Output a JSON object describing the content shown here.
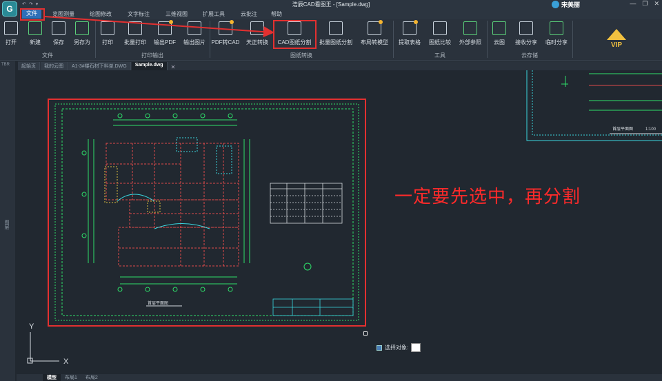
{
  "app": {
    "title": "浩辰CAD看图王 - [Sample.dwg]",
    "logo_letter": "G",
    "brand": "宋美丽",
    "window_controls": [
      "—",
      "❐",
      "✕"
    ]
  },
  "menu": {
    "items": [
      "文件",
      "览图测量",
      "绘图修改",
      "文字标注",
      "三维视图",
      "扩展工具",
      "云批注",
      "帮助"
    ],
    "active": "文件"
  },
  "ribbon": {
    "groups": [
      {
        "label": "文件",
        "buttons": [
          "打开",
          "新建",
          "保存",
          "另存为"
        ]
      },
      {
        "label": "打印输出",
        "buttons": [
          "打印",
          "批量打印",
          "输出PDF",
          "输出图片"
        ]
      },
      {
        "label": "图纸转换",
        "buttons": [
          "PDF转CAD",
          "天正转换",
          "CAD图纸分割",
          "批量图纸分割",
          "布局转模型"
        ]
      },
      {
        "label": "工具",
        "buttons": [
          "提取表格",
          "图纸比较",
          "外部参照"
        ]
      },
      {
        "label": "云存储",
        "buttons": [
          "云图",
          "接收分享",
          "临时分享"
        ]
      }
    ],
    "vip_label": "VIP"
  },
  "doc_tabs": {
    "items": [
      "起始页",
      "我的云图",
      "A1-3#楼石材下料单.DWG",
      "Sample.dwg"
    ],
    "active": "Sample.dwg",
    "close": "✕"
  },
  "left_strip": {
    "tag": "TBR",
    "label": "图层"
  },
  "canvas": {
    "annotation": "一定要先选中，再分割",
    "select_prompt": "选择对象:",
    "drawing_title": "首层平面图",
    "drawing_scale": "1:100",
    "ucs_x": "X",
    "ucs_y": "Y"
  },
  "bottom_tabs": {
    "items": [
      "模型",
      "布局1",
      "布局2"
    ],
    "active": "模型"
  },
  "colors": {
    "accent": "#2e6fb8",
    "highlight": "#e33030",
    "annotation": "#ff2a2a",
    "cad_green": "#2ee06a",
    "cad_cyan": "#3ad8e0",
    "cad_red": "#e04a4a"
  }
}
